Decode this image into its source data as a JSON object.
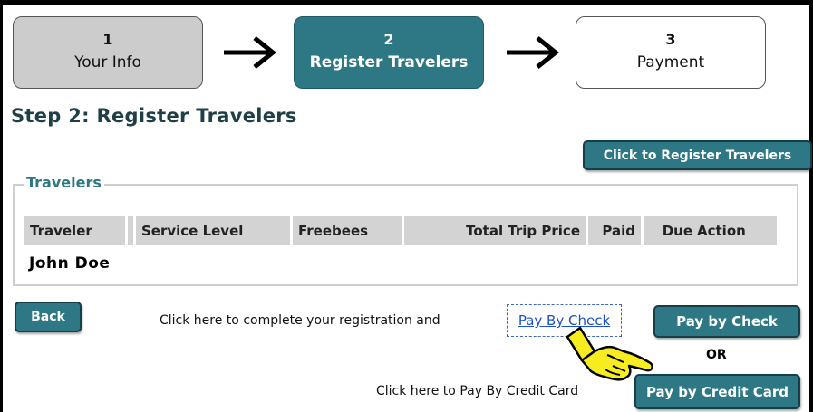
{
  "steps": [
    {
      "number": "1",
      "label": "Your Info"
    },
    {
      "number": "2",
      "label": "Register Travelers"
    },
    {
      "number": "3",
      "label": "Payment"
    }
  ],
  "page_title": "Step 2: Register Travelers",
  "register_button": "Click to Register Travelers",
  "travelers": {
    "legend": "Travelers",
    "columns": [
      "Traveler",
      "Service Level",
      "Freebees",
      "Total Trip Price",
      "Paid",
      "Due",
      "Action"
    ],
    "rows": [
      {
        "name": "John Doe"
      }
    ]
  },
  "back_button": "Back",
  "check_message": "Click here to complete your registration and",
  "check_link": "Pay By Check",
  "pay_check_button": "Pay by Check",
  "or_text": "OR",
  "credit_message": "Click here to Pay By Credit Card",
  "pay_credit_button": "Pay by Credit Card",
  "colors": {
    "accent": "#2d7884",
    "step_inactive": "#cccccc",
    "link": "#1a52c9",
    "hand": "#f7ec1f"
  },
  "icons": {
    "arrow": "right-arrow-icon",
    "pointer": "pointing-hand-icon"
  }
}
